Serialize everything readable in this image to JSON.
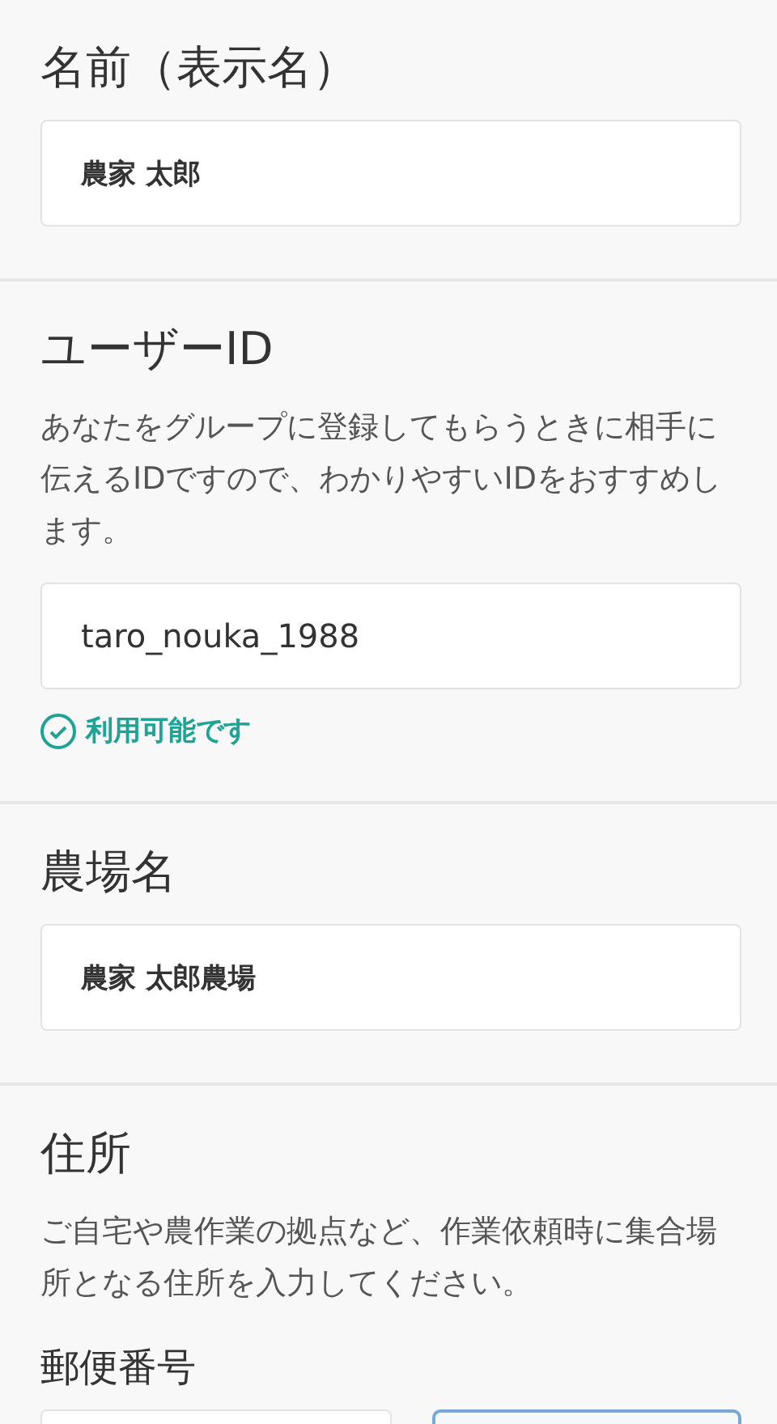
{
  "sections": [
    {
      "title": "名前（表示名）",
      "fields": [
        {
          "value": "農家 太郎",
          "bold": true
        }
      ]
    },
    {
      "title": "ユーザーID",
      "description": "あなたをグループに登録してもらうときに相手に伝えるIDですので、わかりやすいIDをおすすめします。",
      "fields": [
        {
          "value": "taro_nouka_1988",
          "bold": false
        }
      ],
      "status": {
        "kind": "success",
        "text": "利用可能です"
      }
    },
    {
      "title": "農場名",
      "fields": [
        {
          "value": "農家 太郎農場",
          "bold": true
        }
      ]
    },
    {
      "title": "住所",
      "description": "ご自宅や農作業の拠点など、作業依頼時に集合場所となる住所を入力してください。",
      "subtitle": "郵便番号",
      "postal": true
    }
  ]
}
